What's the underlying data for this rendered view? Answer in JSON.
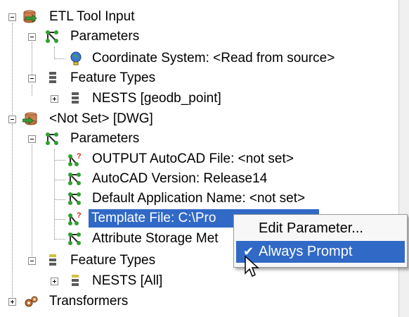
{
  "tree": {
    "etl_input": {
      "label": "ETL Tool Input"
    },
    "etl_parameters": {
      "label": "Parameters"
    },
    "coord_system": {
      "label": "Coordinate System: <Read from source>"
    },
    "etl_feature_types": {
      "label": "Feature Types"
    },
    "nests_geodb": {
      "label": "NESTS [geodb_point]"
    },
    "dwg_output": {
      "label": "<Not Set> [DWG]"
    },
    "dwg_parameters": {
      "label": "Parameters"
    },
    "output_file": {
      "label": "OUTPUT AutoCAD File: <not set>"
    },
    "autocad_version": {
      "label": "AutoCAD Version: Release14"
    },
    "default_app_name": {
      "label": "Default Application Name: <not set>"
    },
    "template_file": {
      "label": "Template File: C:\\Pro"
    },
    "attr_storage": {
      "label": "Attribute Storage Met"
    },
    "dwg_feature_types": {
      "label": "Feature Types"
    },
    "nests_all": {
      "label": "NESTS [All]"
    },
    "transformers": {
      "label": "Transformers"
    }
  },
  "context_menu": {
    "edit_parameter": "Edit Parameter...",
    "always_prompt": "Always Prompt",
    "always_prompt_check": "✔"
  },
  "colors": {
    "selection": "#3169c6",
    "menu_bg": "#f7f7f7"
  }
}
